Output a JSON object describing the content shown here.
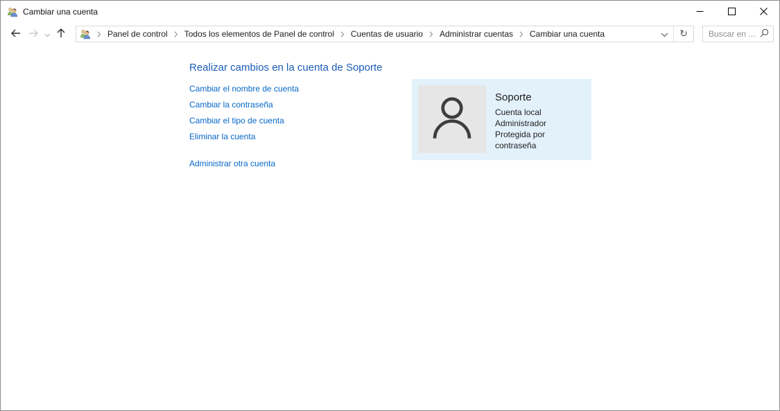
{
  "window": {
    "title": "Cambiar una cuenta"
  },
  "toolbar": {
    "breadcrumb": [
      "Panel de control",
      "Todos los elementos de Panel de control",
      "Cuentas de usuario",
      "Administrar cuentas",
      "Cambiar una cuenta"
    ],
    "search_placeholder": "Buscar en ...",
    "refresh_glyph": "↻"
  },
  "main": {
    "heading": "Realizar cambios en la cuenta de Soporte",
    "links": [
      "Cambiar el nombre de cuenta",
      "Cambiar la contraseña",
      "Cambiar el tipo de cuenta",
      "Eliminar la cuenta"
    ],
    "manage_other_link": "Administrar otra cuenta",
    "account": {
      "name": "Soporte",
      "details": [
        "Cuenta local",
        "Administrador",
        "Protegida por contraseña"
      ]
    }
  },
  "icons": {
    "app": "user-accounts-two-people",
    "back": "arrow-left",
    "forward": "arrow-right-disabled",
    "history_dropdown": "chevron-down",
    "up": "arrow-up",
    "breadcrumb_separator": "chevron-right",
    "address_dropdown": "chevron-down",
    "refresh": "refresh-circular-arrow",
    "search": "magnifier",
    "avatar": "person-outline",
    "minimize": "minimize-line",
    "maximize": "maximize-square",
    "close": "close-x"
  },
  "colors": {
    "heading_blue": "#1a5cb8",
    "link_blue": "#0667c8",
    "card_bg": "#e3f1fb",
    "avatar_bg": "#e6e6e6",
    "window_border": "#8a8a8a",
    "box_border": "#d9d9d9"
  }
}
